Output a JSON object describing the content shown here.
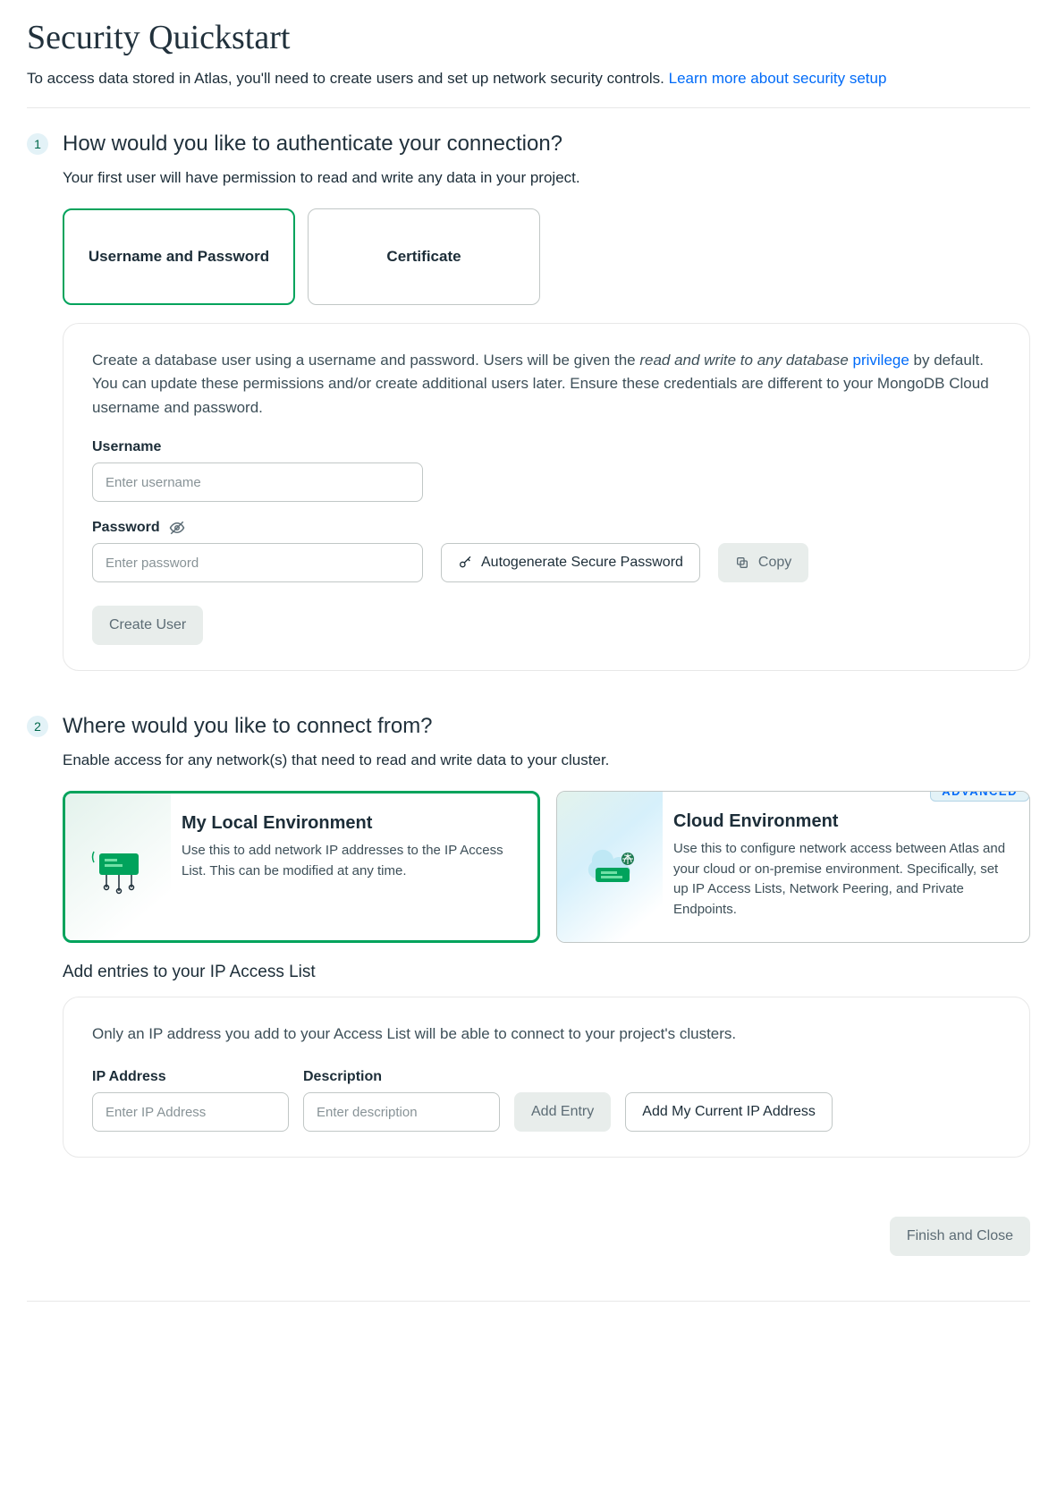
{
  "header": {
    "title": "Security Quickstart",
    "subtitle_prefix": "To access data stored in Atlas, you'll need to create users and set up network security controls. ",
    "subtitle_link": "Learn more about security setup"
  },
  "step1": {
    "number": "1",
    "title": "How would you like to authenticate your connection?",
    "desc": "Your first user will have permission to read and write any data in your project.",
    "tabs": {
      "username_password": "Username and Password",
      "certificate": "Certificate"
    },
    "panel": {
      "text_before_em": "Create a database user using a username and password. Users will be given the ",
      "text_em": "read and write to any database ",
      "privilege_link": "privilege",
      "text_after_link": " by default. You can update these permissions and/or create additional users later. Ensure these credentials are different to your MongoDB Cloud username and password.",
      "username_label": "Username",
      "username_placeholder": "Enter username",
      "password_label": "Password",
      "password_placeholder": "Enter password",
      "autogen_label": "Autogenerate Secure Password",
      "copy_label": "Copy",
      "create_user_label": "Create User"
    }
  },
  "step2": {
    "number": "2",
    "title": "Where would you like to connect from?",
    "desc": "Enable access for any network(s) that need to read and write data to your cluster.",
    "advanced_badge": "ADVANCED",
    "local": {
      "title": "My Local Environment",
      "desc": "Use this to add network IP addresses to the IP Access List. This can be modified at any time."
    },
    "cloud": {
      "title": "Cloud Environment",
      "desc": "Use this to configure network access between Atlas and your cloud or on-premise environment. Specifically, set up IP Access Lists, Network Peering, and Private Endpoints."
    },
    "ip_section": {
      "heading": "Add entries to your IP Access List",
      "panel_text": "Only an IP address you add to your Access List will be able to connect to your project's clusters.",
      "ip_label": "IP Address",
      "ip_placeholder": "Enter IP Address",
      "desc_label": "Description",
      "desc_placeholder": "Enter description",
      "add_entry_label": "Add Entry",
      "add_current_label": "Add My Current IP Address"
    }
  },
  "footer": {
    "finish_label": "Finish and Close"
  }
}
